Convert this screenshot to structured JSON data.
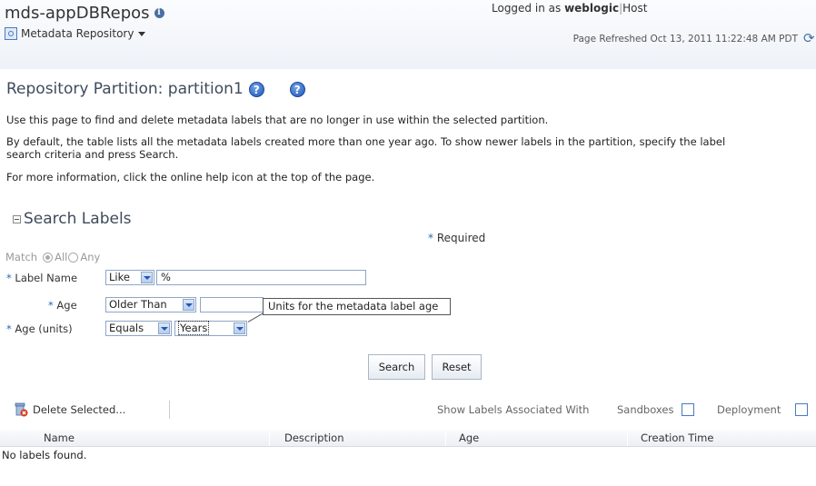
{
  "header": {
    "app_title": "mds-appDBRepos",
    "menu_label": "Metadata Repository",
    "logged_prefix": "Logged in as",
    "user": "weblogic",
    "separator": "|",
    "host": "Host",
    "refreshed": "Page Refreshed Oct 13, 2011 11:22:48 AM PDT"
  },
  "page": {
    "title": "Repository Partition: partition1",
    "para1": "Use this page to find and delete metadata labels that are no longer in use within the selected partition.",
    "para2_line1": "By default, the table lists all the metadata labels created more than one year ago. To show newer labels in the partition, specify the label",
    "para2_line2": "search criteria and press Search.",
    "para3": "For more information, click the online help icon at the top of the page."
  },
  "search": {
    "section_title": "Search Labels",
    "required_star": "*",
    "required_label": "Required",
    "match_label": "Match",
    "match_all": "All",
    "match_any": "Any",
    "label_name_label": "Label Name",
    "label_name_operator": "Like",
    "label_name_value": "%",
    "age_label": "Age",
    "age_operator": "Older Than",
    "age_value": "",
    "age_units_label": "Age (units)",
    "age_units_operator": "Equals",
    "age_units_value": "Years",
    "tooltip": "Units for the metadata label age",
    "search_button": "Search",
    "reset_button": "Reset"
  },
  "toolbar": {
    "delete_label": "Delete Selected...",
    "show_labels": "Show Labels Associated With",
    "sandboxes": "Sandboxes",
    "deployment": "Deployment"
  },
  "table": {
    "columns": [
      "Name",
      "Description",
      "Age",
      "Creation Time"
    ],
    "empty_text": "No labels found."
  }
}
